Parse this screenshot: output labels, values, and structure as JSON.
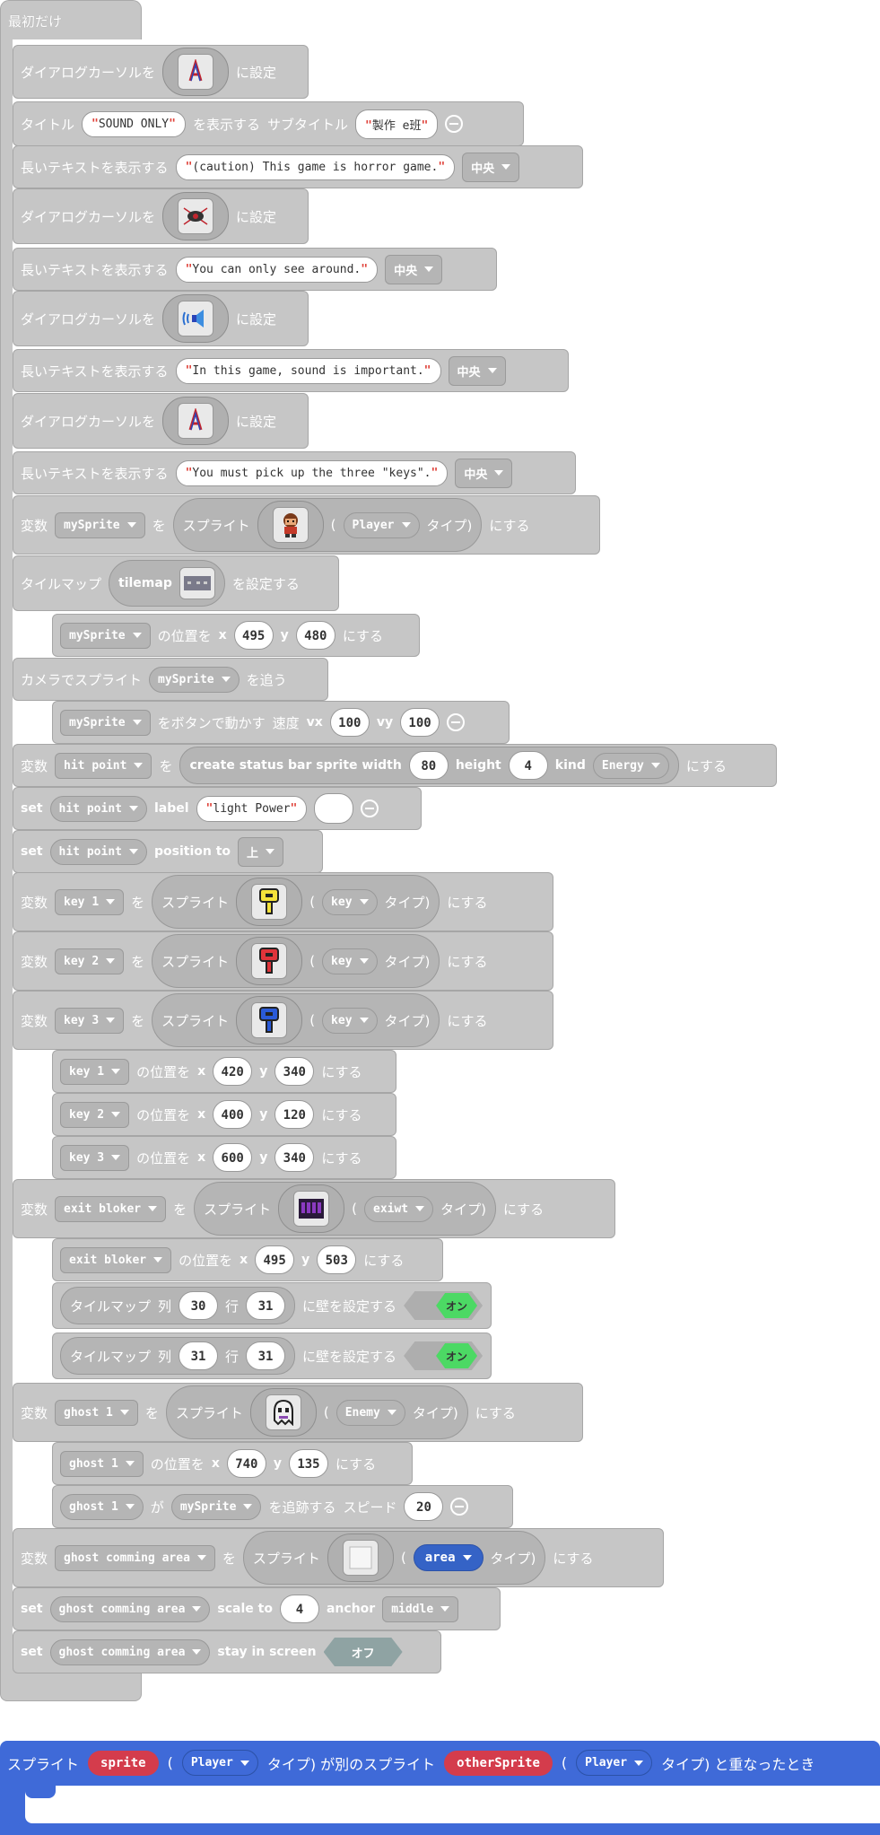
{
  "hat": {
    "label": "最初だけ"
  },
  "l": {
    "cursor_pre": "ダイアログカーソルを",
    "cursor_post": "に設定",
    "title_pre": "タイトル",
    "title_mid": "を表示する",
    "subtitle": "サブタイトル",
    "longtext": "長いテキストを表示する",
    "var": "変数",
    "wo": "を",
    "sprite": "スプライト",
    "type": "タイプ)",
    "nisuru": "にする",
    "tilemap": "タイルマップ",
    "set_tilemap": "を設定する",
    "pos": "の位置を",
    "x": "x",
    "y": "y",
    "camera": "カメラでスプライト",
    "follow": "を追う",
    "move_btn": "をボタンで動かす",
    "speed": "速度",
    "vx": "vx",
    "vy": "vy",
    "set": "set",
    "label": "label",
    "position_to": "position to",
    "col": "列",
    "row": "行",
    "wall": "に壁を設定する",
    "ga": "が",
    "chase": "を追跡する",
    "chase_speed": "スピード",
    "scale_to": "scale to",
    "anchor": "anchor",
    "stay": "stay in screen",
    "create_sb": "create status bar sprite width",
    "height": "height",
    "kind": "kind",
    "paren": "("
  },
  "values": {
    "title": "SOUND ONLY",
    "subtitle": "製作 e班",
    "text1": "(caution) This game is horror game.",
    "text2": "You can only see around.",
    "text3": "In this game, sound is important.",
    "text4": "You must pick up the three \"keys\".",
    "center": "中央",
    "mySprite": "mySprite",
    "Player": "Player",
    "tilemap": "tilemap",
    "hit_point": "hit point",
    "Energy": "Energy",
    "light_power": "light Power",
    "top": "上",
    "key1": "key 1",
    "key2": "key 2",
    "key3": "key 3",
    "key": "key",
    "exit_bloker": "exit bloker",
    "exiwt": "exiwt",
    "ghost1": "ghost 1",
    "Enemy": "Enemy",
    "ghost_area": "ghost comming area",
    "area": "area",
    "middle": "middle",
    "on": "オン",
    "off": "オフ",
    "n495": "495",
    "n480": "480",
    "n100": "100",
    "n80": "80",
    "n4": "4",
    "n420": "420",
    "n340": "340",
    "n400": "400",
    "n120": "120",
    "n600": "600",
    "n503": "503",
    "n30": "30",
    "n31": "31",
    "n740": "740",
    "n135": "135",
    "n20": "20"
  },
  "event": {
    "sprite": "スプライト",
    "sprite_var": "sprite",
    "type_a": "Player",
    "mid": "タイプ) が別のスプライト",
    "other_var": "otherSprite",
    "type_b": "Player",
    "end": "タイプ) と重なったとき",
    "paren": "("
  },
  "colors": {
    "block": "#c6c6c6",
    "event_blue": "#3f6ad8",
    "var_red": "#d43c4c",
    "toggle_on": "#4cd964"
  },
  "icons": [
    "dialog-cursor-icon",
    "sprite-image-icon",
    "tilemap-image-icon",
    "key-icon",
    "ghost-icon"
  ]
}
